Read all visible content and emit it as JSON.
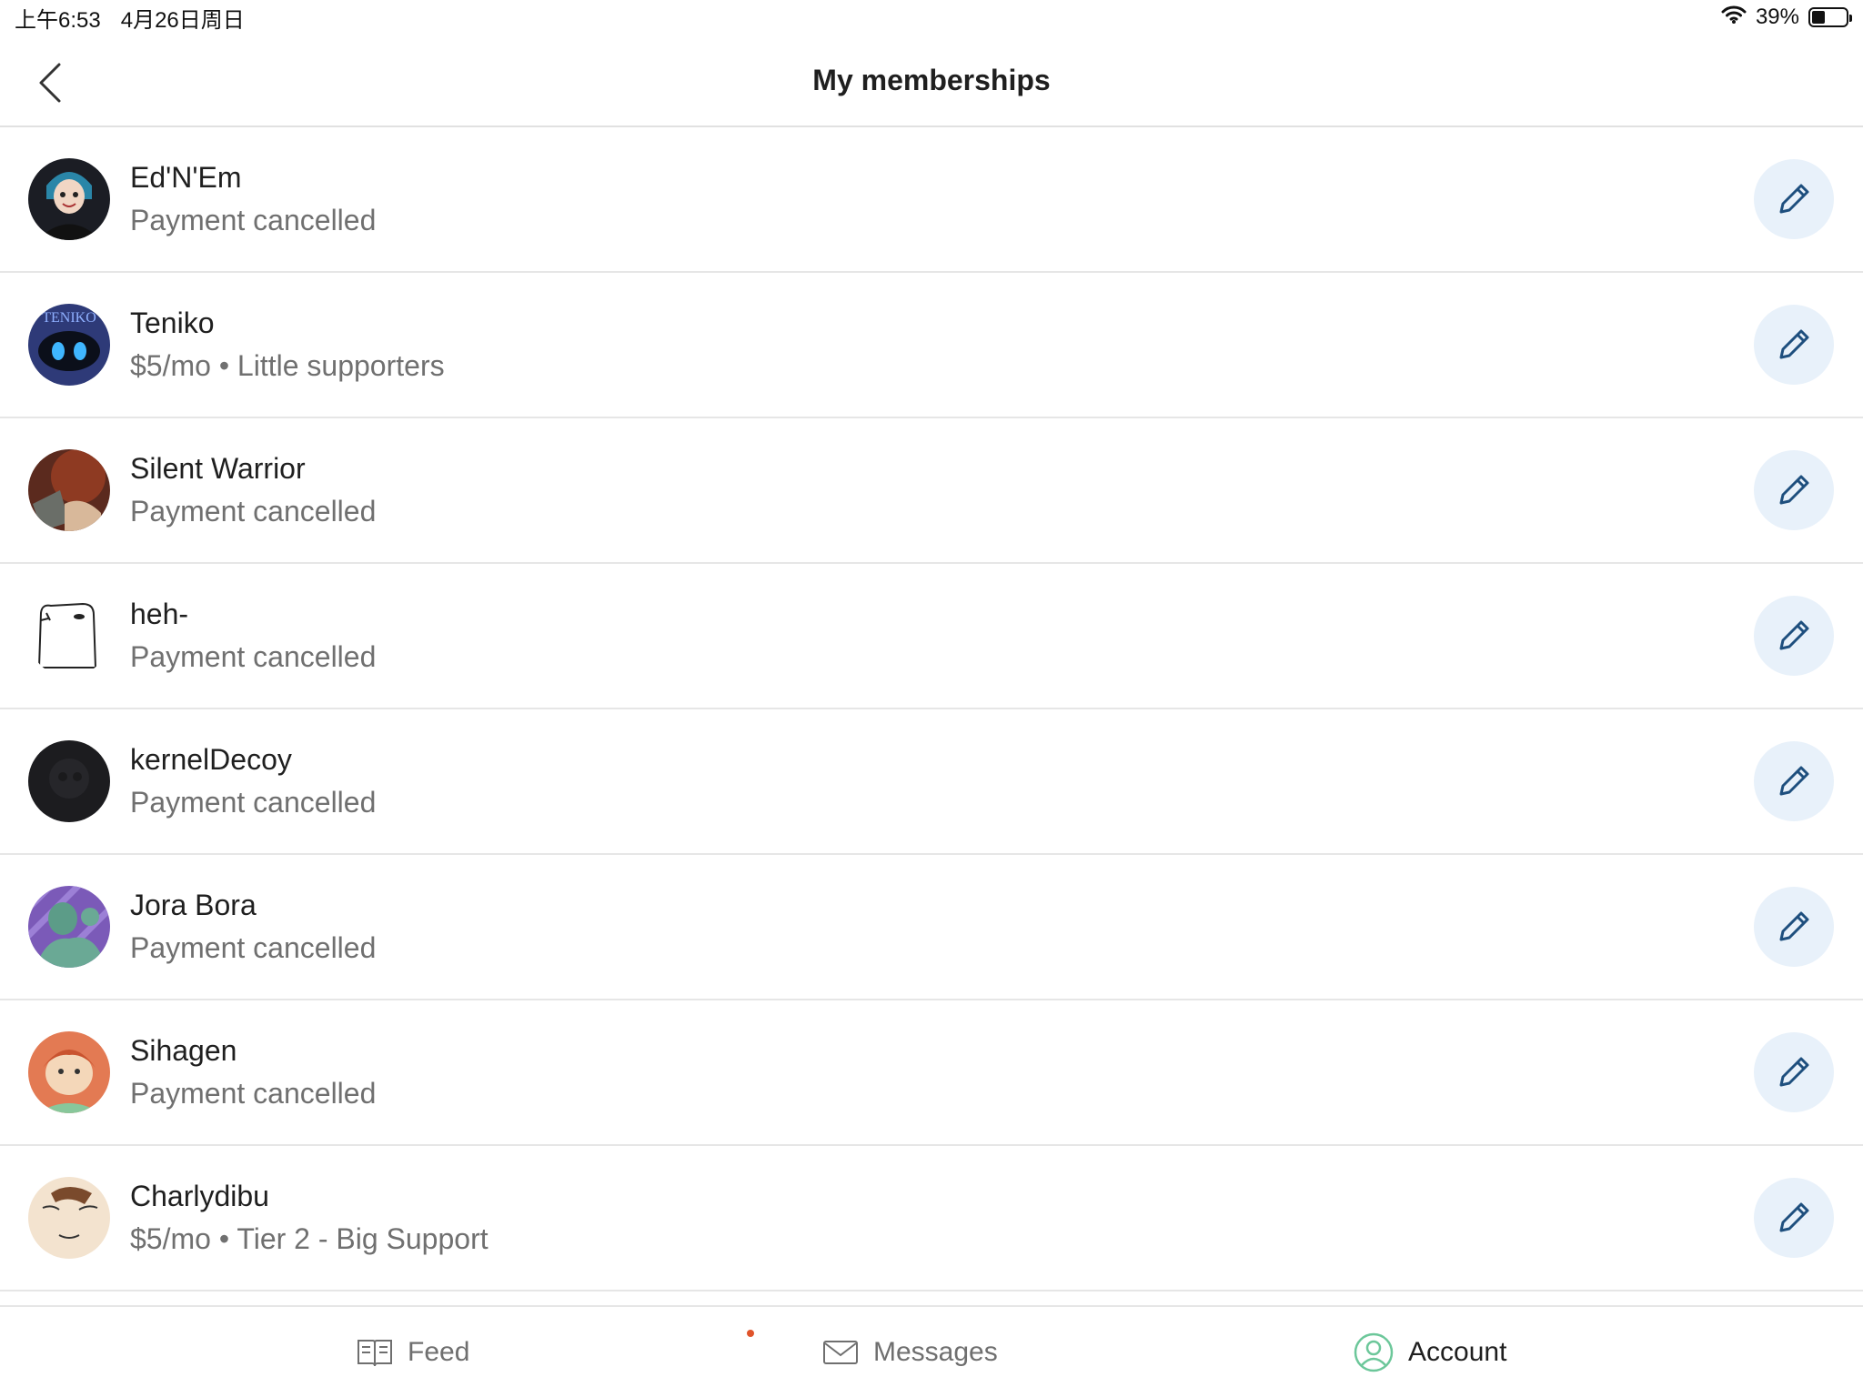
{
  "status_bar": {
    "time": "上午6:53",
    "date": "4月26日周日",
    "battery": "39%",
    "battery_level": 0.39
  },
  "header": {
    "title": "My memberships"
  },
  "memberships": [
    {
      "name": "Ed'N'Em",
      "status": "Payment cancelled"
    },
    {
      "name": "Teniko",
      "status": "$5/mo • Little supporters",
      "avatar_text": "TENIKO"
    },
    {
      "name": "Silent Warrior",
      "status": "Payment cancelled"
    },
    {
      "name": "heh-",
      "status": "Payment cancelled"
    },
    {
      "name": "kernelDecoy",
      "status": "Payment cancelled"
    },
    {
      "name": "Jora Bora",
      "status": "Payment cancelled"
    },
    {
      "name": "Sihagen",
      "status": "Payment cancelled"
    },
    {
      "name": "Charlydibu",
      "status": "$5/mo • Tier 2 - Big Support"
    }
  ],
  "tab_bar": {
    "feed": "Feed",
    "messages": "Messages",
    "account": "Account"
  },
  "colors": {
    "edit_button_bg": "#e8f1fa",
    "edit_icon": "#1e4f7e",
    "account_icon": "#6cc79a",
    "notification_dot": "#e0542b"
  }
}
